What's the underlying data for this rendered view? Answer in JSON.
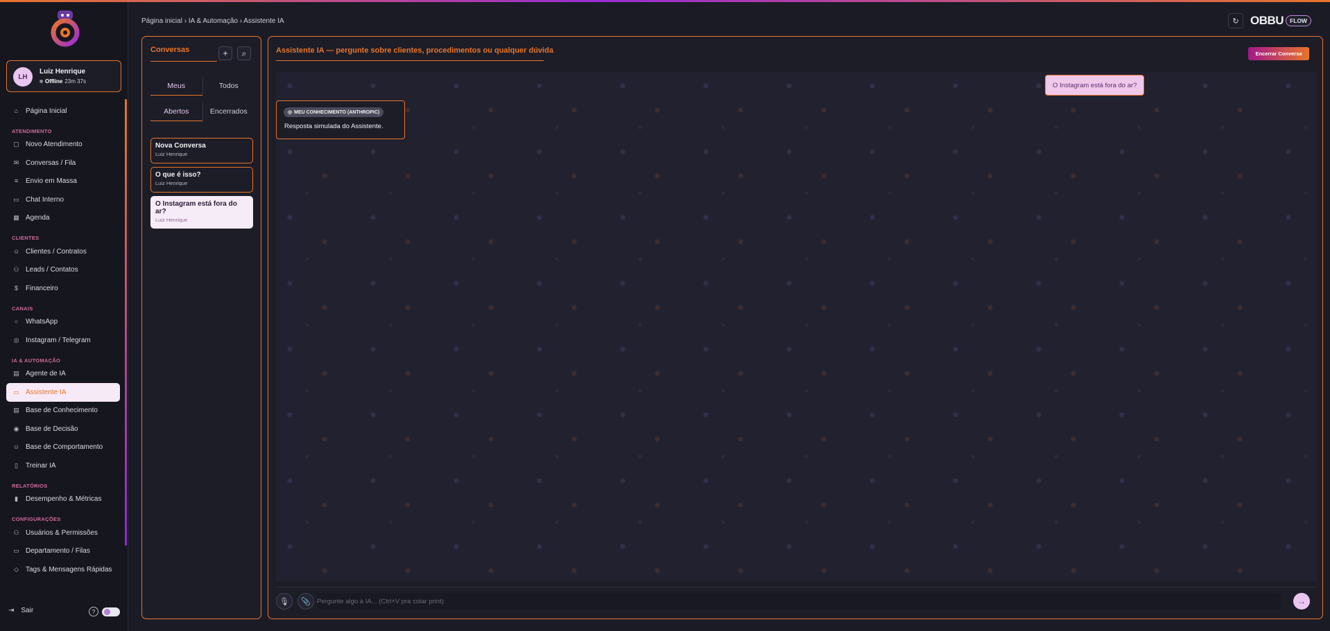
{
  "sidebar": {
    "user": {
      "initials": "LH",
      "name": "Luiz Henrique",
      "status": "Offline",
      "time": "23m 37s"
    },
    "home": {
      "label": "Página Inicial"
    },
    "sections": [
      {
        "title": "ATENDIMENTO",
        "items": [
          {
            "label": "Novo Atendimento"
          },
          {
            "label": "Conversas / Fila"
          },
          {
            "label": "Envio em Massa"
          },
          {
            "label": "Chat Interno"
          },
          {
            "label": "Agenda"
          }
        ]
      },
      {
        "title": "CLIENTES",
        "items": [
          {
            "label": "Clientes / Contratos"
          },
          {
            "label": "Leads / Contatos"
          },
          {
            "label": "Financeiro"
          }
        ]
      },
      {
        "title": "CANAIS",
        "items": [
          {
            "label": "WhatsApp"
          },
          {
            "label": "Instagram / Telegram"
          }
        ]
      },
      {
        "title": "IA & AUTOMAÇÃO",
        "items": [
          {
            "label": "Agente de IA"
          },
          {
            "label": "Assistente IA"
          },
          {
            "label": "Base de Conhecimento"
          },
          {
            "label": "Base de Decisão"
          },
          {
            "label": "Base de Comportamento"
          },
          {
            "label": "Treinar IA"
          }
        ]
      },
      {
        "title": "RELATÓRIOS",
        "items": [
          {
            "label": "Desempenho & Métricas"
          }
        ]
      },
      {
        "title": "CONFIGURAÇÕES",
        "items": [
          {
            "label": "Usuários & Permissões"
          },
          {
            "label": "Departamento / Filas"
          },
          {
            "label": "Tags & Mensagens Rápidas"
          }
        ]
      }
    ],
    "logout": "Sair",
    "help": "?"
  },
  "header": {
    "breadcrumb": "Página inicial › IA & Automação › Assistente IA",
    "refresh_icon": "↻",
    "brand": "OBBU",
    "brand_tag": "FLOW"
  },
  "conversations": {
    "title": "Conversas",
    "add_icon": "+",
    "search_icon": "⌕",
    "tabs_owner": [
      "Meus",
      "Todos"
    ],
    "tabs_status": [
      "Abertos",
      "Encerrados"
    ],
    "items": [
      {
        "title": "Nova Conversa",
        "subtitle": "Luiz Henrique"
      },
      {
        "title": "O que é isso?",
        "subtitle": "Luiz Henrique"
      },
      {
        "title": "O Instagram está fora do ar?",
        "subtitle": "Luiz Henrique"
      }
    ]
  },
  "chat": {
    "title": "Assistente IA — pergunte sobre clientes, procedimentos ou qualquer dúvida",
    "end_button": "Encerrar Conversa",
    "messages": {
      "user": "O Instagram está fora do ar?",
      "bot_badge": "MEU CONHECIMENTO (ANTHROPIC)",
      "bot_text": "Resposta simulada do Assistente."
    },
    "input_placeholder": "Pergunte algo à IA... (Ctrl+V pra colar print)",
    "mic_icon": "🎙",
    "attach_icon": "📎",
    "send_icon": "→"
  },
  "colors": {
    "accent": "#e8752a",
    "purple": "#9b2cd6",
    "background": "#1b1b26"
  }
}
